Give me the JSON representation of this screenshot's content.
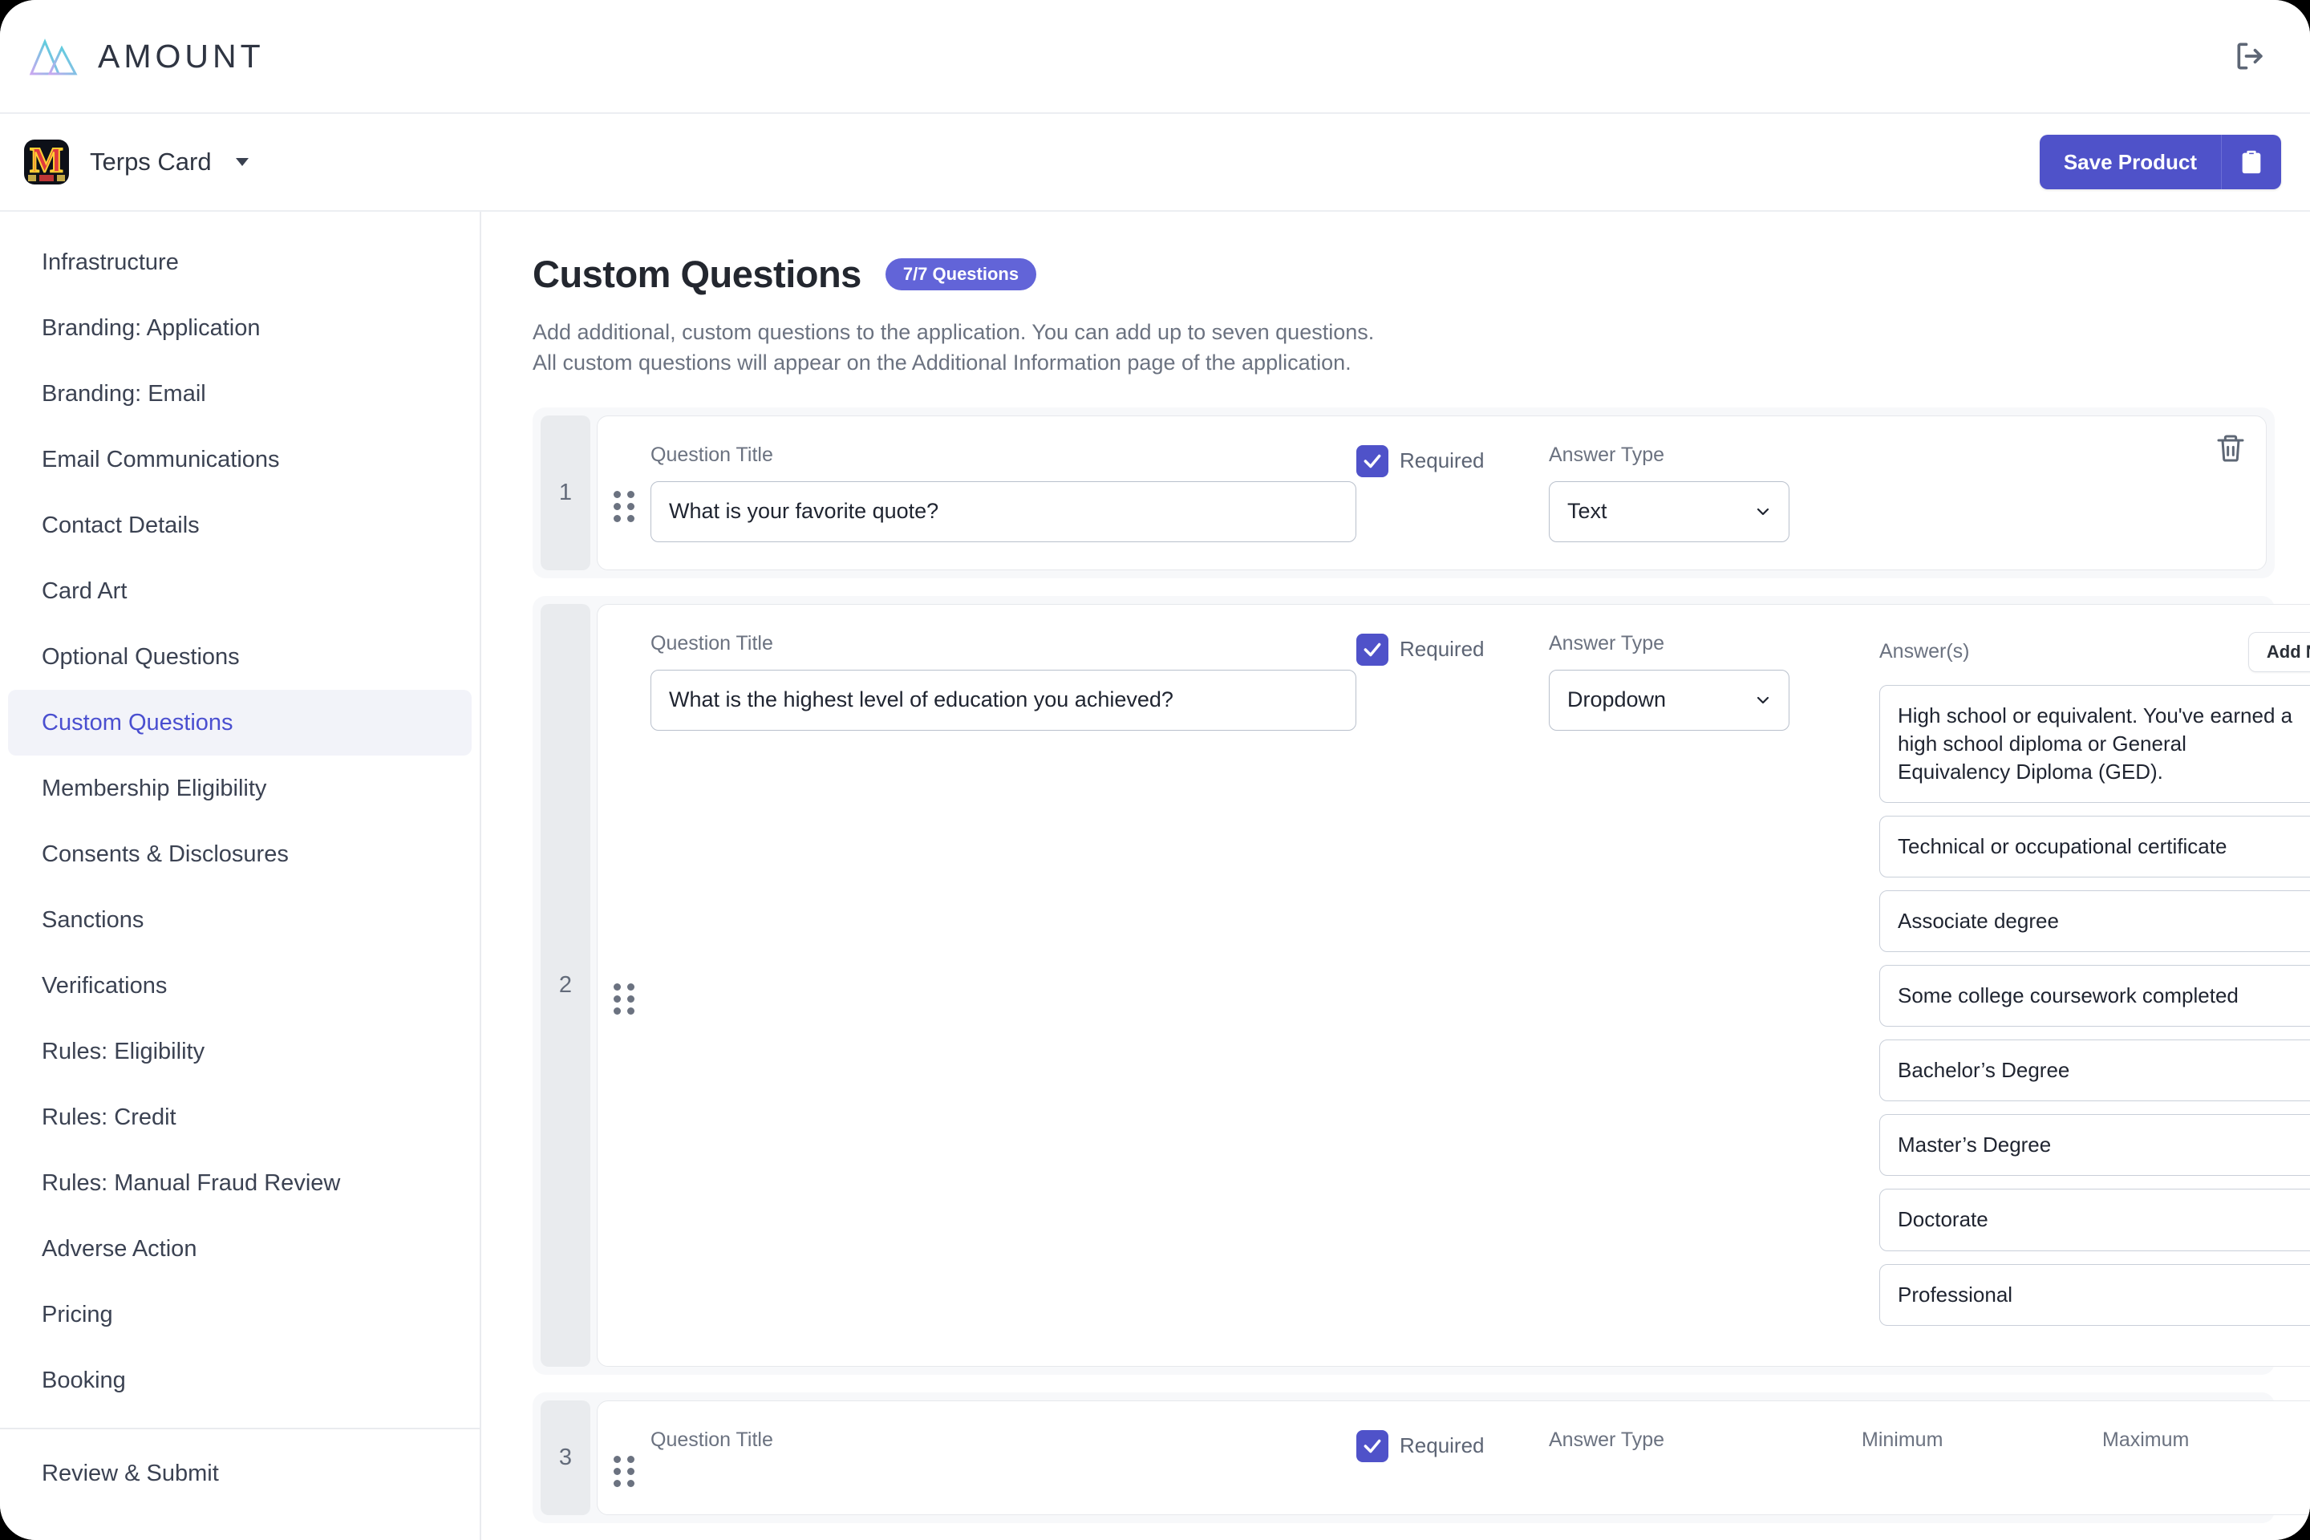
{
  "brand": {
    "name": "AMOUNT",
    "logo_icon": "mountains-logo",
    "logout_icon": "logout-icon"
  },
  "product_bar": {
    "product_logo_letter": "M",
    "product_name": "Terps Card",
    "dropdown_icon": "chevron-down-icon",
    "save_label": "Save Product",
    "save_icon": "clipboard-icon"
  },
  "sidebar": {
    "items": [
      {
        "label": "Infrastructure",
        "active": false
      },
      {
        "label": "Branding: Application",
        "active": false
      },
      {
        "label": "Branding: Email",
        "active": false
      },
      {
        "label": "Email Communications",
        "active": false
      },
      {
        "label": "Contact Details",
        "active": false
      },
      {
        "label": "Card Art",
        "active": false
      },
      {
        "label": "Optional Questions",
        "active": false
      },
      {
        "label": "Custom Questions",
        "active": true
      },
      {
        "label": "Membership Eligibility",
        "active": false
      },
      {
        "label": "Consents & Disclosures",
        "active": false
      },
      {
        "label": "Sanctions",
        "active": false
      },
      {
        "label": "Verifications",
        "active": false
      },
      {
        "label": "Rules: Eligibility",
        "active": false
      },
      {
        "label": "Rules: Credit",
        "active": false
      },
      {
        "label": "Rules: Manual Fraud Review",
        "active": false
      },
      {
        "label": "Adverse Action",
        "active": false
      },
      {
        "label": "Pricing",
        "active": false
      },
      {
        "label": "Booking",
        "active": false
      }
    ],
    "footer_item": {
      "label": "Review & Submit",
      "active": false
    }
  },
  "page": {
    "title": "Custom Questions",
    "badge": "7/7 Questions",
    "description_line1": "Add additional, custom questions to the application. You can add up to seven questions.",
    "description_line2": "All custom questions will appear on the Additional Information page of the application."
  },
  "labels": {
    "question_title": "Question Title",
    "required": "Required",
    "answer_type": "Answer Type",
    "answers": "Answer(s)",
    "add_new": "Add New",
    "minimum": "Minimum",
    "maximum": "Maximum",
    "delete_icon": "trash-icon",
    "drag_icon": "drag-handle-icon",
    "remove_icon": "close-icon",
    "scroll_top_icon": "chevron-up-circle-icon"
  },
  "questions": [
    {
      "number": "1",
      "title": "What is your favorite quote?",
      "required": true,
      "answer_type": "Text",
      "answers": []
    },
    {
      "number": "2",
      "title": "What is the highest level of education you achieved?",
      "required": true,
      "answer_type": "Dropdown",
      "answers": [
        "High school or equivalent. You've earned a high school diploma or General Equivalency Diploma (GED).",
        "Technical or occupational certificate",
        "Associate degree",
        "Some college coursework completed",
        "Bachelor’s Degree",
        "Master’s Degree",
        "Doctorate",
        "Professional"
      ]
    },
    {
      "number": "3",
      "title": "",
      "required": true,
      "answer_type": "",
      "answers": []
    }
  ],
  "colors": {
    "accent": "#4f52c9",
    "badge": "#6264d8",
    "active_nav_bg": "#f2f3f9",
    "active_nav_text": "#4a4fd0",
    "card_bg": "#f7f8fa"
  }
}
